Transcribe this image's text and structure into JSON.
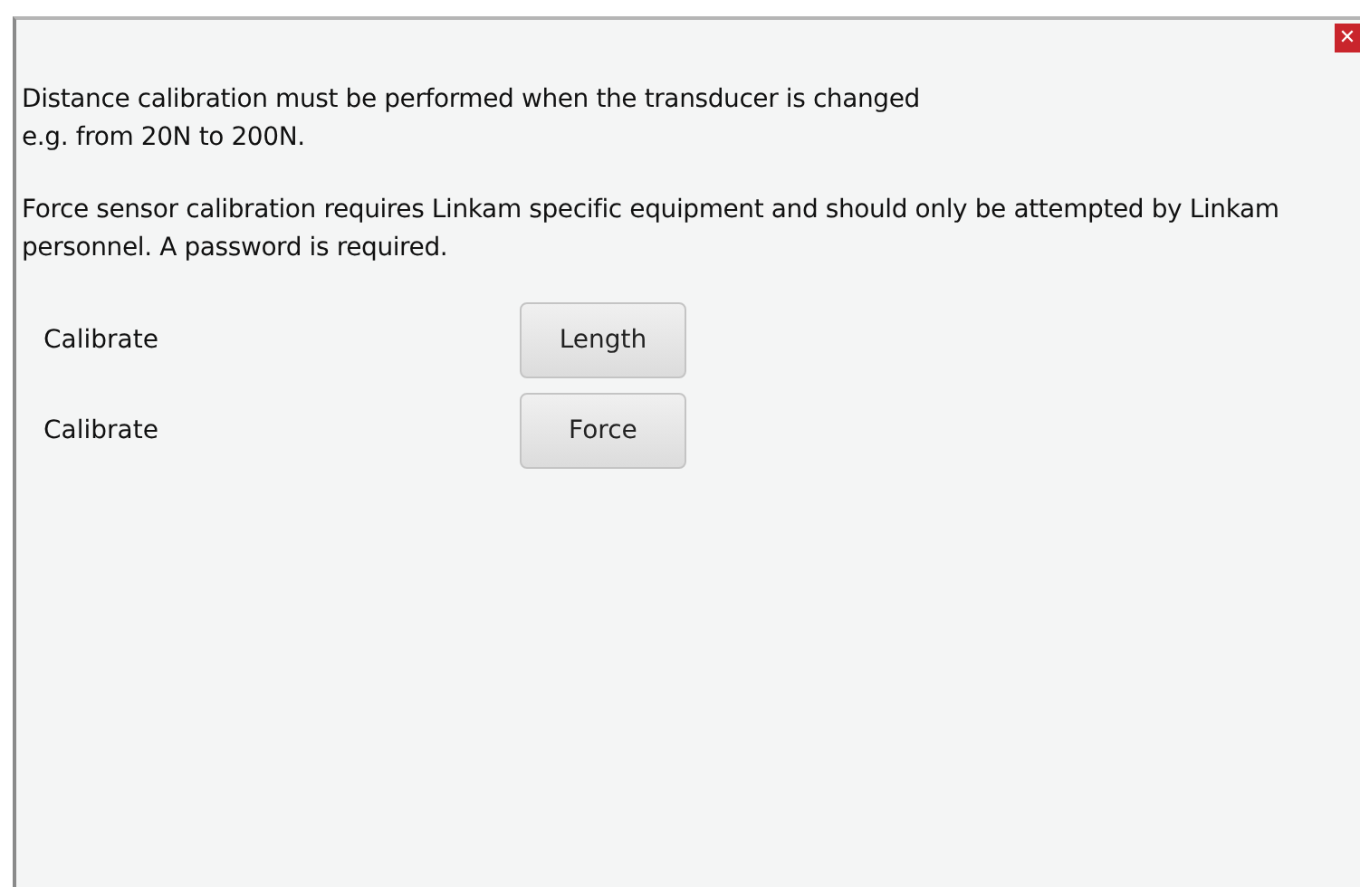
{
  "close_button": {
    "label": "✕"
  },
  "paragraphs": [
    "Distance calibration must be performed when the transducer is changed\ne.g. from 20N to 200N.",
    "Force sensor calibration requires Linkam specific equipment and should only be attempted by Linkam personnel. A password is required."
  ],
  "rows": [
    {
      "label": "Calibrate",
      "button": "Length"
    },
    {
      "label": "Calibrate",
      "button": "Force"
    }
  ]
}
